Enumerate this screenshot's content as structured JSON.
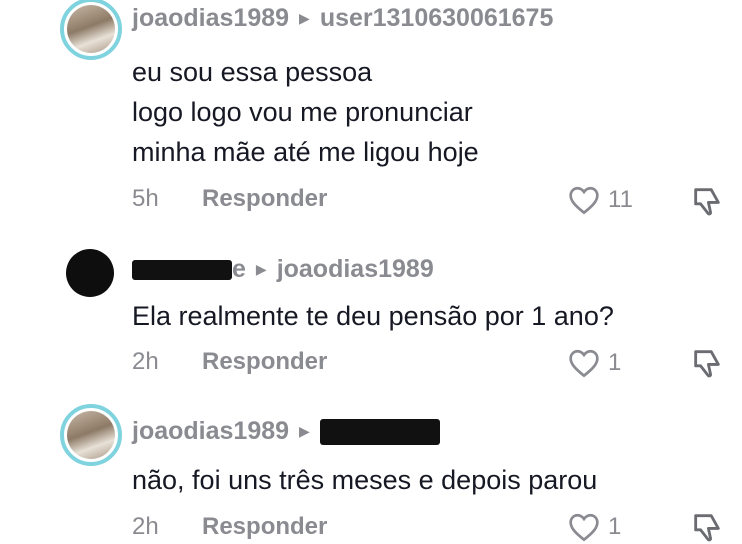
{
  "comments": [
    {
      "username": "joaodias1989",
      "reply_to": "user1310630061675",
      "lines": [
        "eu sou essa pessoa",
        "logo logo vou me pronunciar",
        "minha mãe até me ligou hoje"
      ],
      "time": "5h",
      "reply_label": "Responder",
      "likes": "11",
      "avatar": "photo-avatar"
    },
    {
      "username_redacted": true,
      "username_visible_suffix": "e",
      "reply_to": "joaodias1989",
      "lines": [
        "Ela realmente te deu pensão por 1 ano?"
      ],
      "time": "2h",
      "reply_label": "Responder",
      "likes": "1",
      "avatar": "redacted-avatar"
    },
    {
      "username": "joaodias1989",
      "reply_to_redacted": true,
      "lines": [
        "não, foi uns três meses e depois parou"
      ],
      "time": "2h",
      "reply_label": "Responder",
      "likes": "1",
      "avatar": "photo-avatar"
    }
  ],
  "icons": {
    "reply_arrow": "caret-right-icon",
    "like": "heart-outline-icon",
    "dislike": "thumbs-down-icon"
  },
  "colors": {
    "text": "#161823",
    "muted": "#8a8b91",
    "avatar_ring": "#7fd3de"
  }
}
